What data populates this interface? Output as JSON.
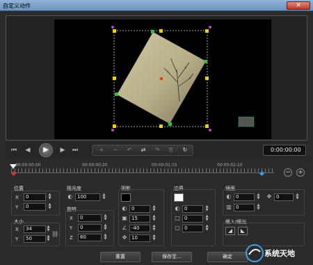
{
  "window": {
    "title": "自定义动作",
    "close_icon": "close-icon",
    "close_glyph": "✕"
  },
  "transport": {
    "buttons": [
      {
        "name": "go-to-start-icon",
        "glyph": "⏮"
      },
      {
        "name": "previous-frame-icon",
        "glyph": "◀"
      },
      {
        "name": "play-icon",
        "glyph": "▶"
      },
      {
        "name": "next-frame-icon",
        "glyph": "▶"
      },
      {
        "name": "go-to-end-icon",
        "glyph": "⏭"
      }
    ],
    "tools": [
      {
        "name": "add-keyframe-icon",
        "glyph": "+"
      },
      {
        "name": "remove-keyframe-icon",
        "glyph": "−"
      },
      {
        "name": "previous-keyframe-icon",
        "glyph": "↶"
      },
      {
        "name": "reverse-keyframes-icon",
        "glyph": "⇄"
      },
      {
        "name": "next-keyframe-icon",
        "glyph": "↷"
      },
      {
        "name": "copy-keyframe-icon",
        "glyph": "⎘"
      },
      {
        "name": "loop-icon",
        "glyph": "↻"
      }
    ],
    "timecode": "0:00:00:00"
  },
  "timeline": {
    "labels": [
      "00:00:00:00",
      "00:00:00:20",
      "00:00:01:15",
      "00:00:02:10"
    ],
    "keyframe_colors": [
      "#d93a2a",
      "#3aa0e0"
    ],
    "zoom_out": "−",
    "zoom_in": "+"
  },
  "properties": {
    "position": {
      "label": "位置",
      "x": "0",
      "y": "0"
    },
    "size": {
      "label": "大小",
      "x": "34",
      "y": "50"
    },
    "opacity": {
      "label": "阻光度",
      "value": "100"
    },
    "rotation": {
      "label": "旋转",
      "x": "0",
      "y": "0",
      "z": "60"
    },
    "shadow": {
      "label": "阴影",
      "color": "#000000",
      "v1": "0",
      "v2": "15",
      "v3": "-40",
      "v4": "10"
    },
    "border": {
      "label": "边界",
      "color": "#ffffff",
      "v1": "0",
      "v2": "0",
      "v3": "0"
    },
    "mirror": {
      "label": "镜面",
      "v1": "0",
      "v2": "0",
      "v3": "0"
    },
    "ease": {
      "label": "缓入/缓出"
    }
  },
  "axes": {
    "x": "X",
    "y": "Y",
    "z": "Z"
  },
  "buttons": {
    "reset": "重置",
    "save_to": "保存至...",
    "ok": "确定"
  },
  "watermark": {
    "text": "系统天地"
  },
  "colors": {
    "handle_yellow": "#f0d000",
    "handle_green": "#30c030",
    "handle_purple": "#c040c0",
    "anchor_red": "#e04010"
  }
}
